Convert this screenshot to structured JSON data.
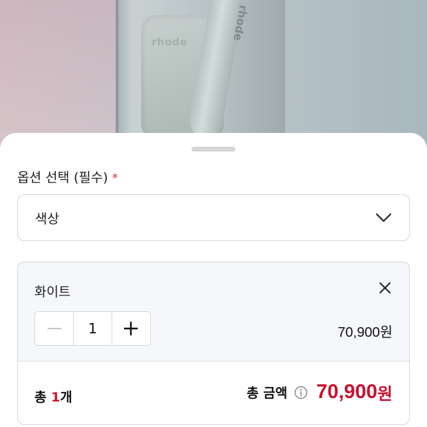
{
  "hero": {
    "case_logo": "rhode",
    "tube_logo": "rhode"
  },
  "sheet": {
    "section_title": "옵션 선택 (필수)",
    "required_mark": "*",
    "select": {
      "value": "색상"
    },
    "option": {
      "name": "화이트",
      "quantity": "1",
      "price": "70,900원"
    },
    "total": {
      "count_prefix": "총 ",
      "count_number": "1",
      "count_suffix": "개",
      "amount_label": "총 금액",
      "amount_value": "70,900",
      "amount_unit": "원"
    }
  },
  "colors": {
    "accent": "#c8102e",
    "required": "#e0263a"
  }
}
